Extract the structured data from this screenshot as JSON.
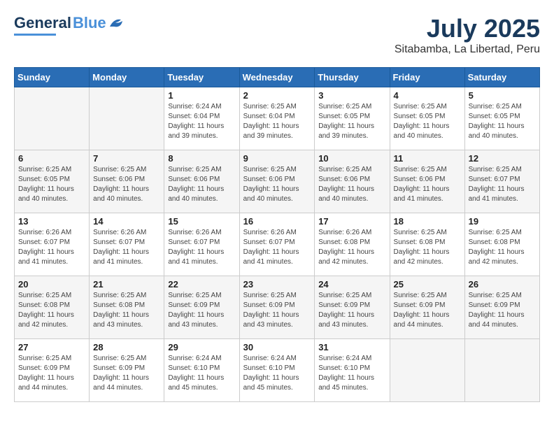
{
  "header": {
    "logo_general": "General",
    "logo_blue": "Blue",
    "month_year": "July 2025",
    "location": "Sitabamba, La Libertad, Peru"
  },
  "weekdays": [
    "Sunday",
    "Monday",
    "Tuesday",
    "Wednesday",
    "Thursday",
    "Friday",
    "Saturday"
  ],
  "weeks": [
    [
      {
        "day": "",
        "detail": ""
      },
      {
        "day": "",
        "detail": ""
      },
      {
        "day": "1",
        "detail": "Sunrise: 6:24 AM\nSunset: 6:04 PM\nDaylight: 11 hours and 39 minutes."
      },
      {
        "day": "2",
        "detail": "Sunrise: 6:25 AM\nSunset: 6:04 PM\nDaylight: 11 hours and 39 minutes."
      },
      {
        "day": "3",
        "detail": "Sunrise: 6:25 AM\nSunset: 6:05 PM\nDaylight: 11 hours and 39 minutes."
      },
      {
        "day": "4",
        "detail": "Sunrise: 6:25 AM\nSunset: 6:05 PM\nDaylight: 11 hours and 40 minutes."
      },
      {
        "day": "5",
        "detail": "Sunrise: 6:25 AM\nSunset: 6:05 PM\nDaylight: 11 hours and 40 minutes."
      }
    ],
    [
      {
        "day": "6",
        "detail": "Sunrise: 6:25 AM\nSunset: 6:05 PM\nDaylight: 11 hours and 40 minutes."
      },
      {
        "day": "7",
        "detail": "Sunrise: 6:25 AM\nSunset: 6:06 PM\nDaylight: 11 hours and 40 minutes."
      },
      {
        "day": "8",
        "detail": "Sunrise: 6:25 AM\nSunset: 6:06 PM\nDaylight: 11 hours and 40 minutes."
      },
      {
        "day": "9",
        "detail": "Sunrise: 6:25 AM\nSunset: 6:06 PM\nDaylight: 11 hours and 40 minutes."
      },
      {
        "day": "10",
        "detail": "Sunrise: 6:25 AM\nSunset: 6:06 PM\nDaylight: 11 hours and 40 minutes."
      },
      {
        "day": "11",
        "detail": "Sunrise: 6:25 AM\nSunset: 6:06 PM\nDaylight: 11 hours and 41 minutes."
      },
      {
        "day": "12",
        "detail": "Sunrise: 6:25 AM\nSunset: 6:07 PM\nDaylight: 11 hours and 41 minutes."
      }
    ],
    [
      {
        "day": "13",
        "detail": "Sunrise: 6:26 AM\nSunset: 6:07 PM\nDaylight: 11 hours and 41 minutes."
      },
      {
        "day": "14",
        "detail": "Sunrise: 6:26 AM\nSunset: 6:07 PM\nDaylight: 11 hours and 41 minutes."
      },
      {
        "day": "15",
        "detail": "Sunrise: 6:26 AM\nSunset: 6:07 PM\nDaylight: 11 hours and 41 minutes."
      },
      {
        "day": "16",
        "detail": "Sunrise: 6:26 AM\nSunset: 6:07 PM\nDaylight: 11 hours and 41 minutes."
      },
      {
        "day": "17",
        "detail": "Sunrise: 6:26 AM\nSunset: 6:08 PM\nDaylight: 11 hours and 42 minutes."
      },
      {
        "day": "18",
        "detail": "Sunrise: 6:25 AM\nSunset: 6:08 PM\nDaylight: 11 hours and 42 minutes."
      },
      {
        "day": "19",
        "detail": "Sunrise: 6:25 AM\nSunset: 6:08 PM\nDaylight: 11 hours and 42 minutes."
      }
    ],
    [
      {
        "day": "20",
        "detail": "Sunrise: 6:25 AM\nSunset: 6:08 PM\nDaylight: 11 hours and 42 minutes."
      },
      {
        "day": "21",
        "detail": "Sunrise: 6:25 AM\nSunset: 6:08 PM\nDaylight: 11 hours and 43 minutes."
      },
      {
        "day": "22",
        "detail": "Sunrise: 6:25 AM\nSunset: 6:09 PM\nDaylight: 11 hours and 43 minutes."
      },
      {
        "day": "23",
        "detail": "Sunrise: 6:25 AM\nSunset: 6:09 PM\nDaylight: 11 hours and 43 minutes."
      },
      {
        "day": "24",
        "detail": "Sunrise: 6:25 AM\nSunset: 6:09 PM\nDaylight: 11 hours and 43 minutes."
      },
      {
        "day": "25",
        "detail": "Sunrise: 6:25 AM\nSunset: 6:09 PM\nDaylight: 11 hours and 44 minutes."
      },
      {
        "day": "26",
        "detail": "Sunrise: 6:25 AM\nSunset: 6:09 PM\nDaylight: 11 hours and 44 minutes."
      }
    ],
    [
      {
        "day": "27",
        "detail": "Sunrise: 6:25 AM\nSunset: 6:09 PM\nDaylight: 11 hours and 44 minutes."
      },
      {
        "day": "28",
        "detail": "Sunrise: 6:25 AM\nSunset: 6:09 PM\nDaylight: 11 hours and 44 minutes."
      },
      {
        "day": "29",
        "detail": "Sunrise: 6:24 AM\nSunset: 6:10 PM\nDaylight: 11 hours and 45 minutes."
      },
      {
        "day": "30",
        "detail": "Sunrise: 6:24 AM\nSunset: 6:10 PM\nDaylight: 11 hours and 45 minutes."
      },
      {
        "day": "31",
        "detail": "Sunrise: 6:24 AM\nSunset: 6:10 PM\nDaylight: 11 hours and 45 minutes."
      },
      {
        "day": "",
        "detail": ""
      },
      {
        "day": "",
        "detail": ""
      }
    ]
  ]
}
